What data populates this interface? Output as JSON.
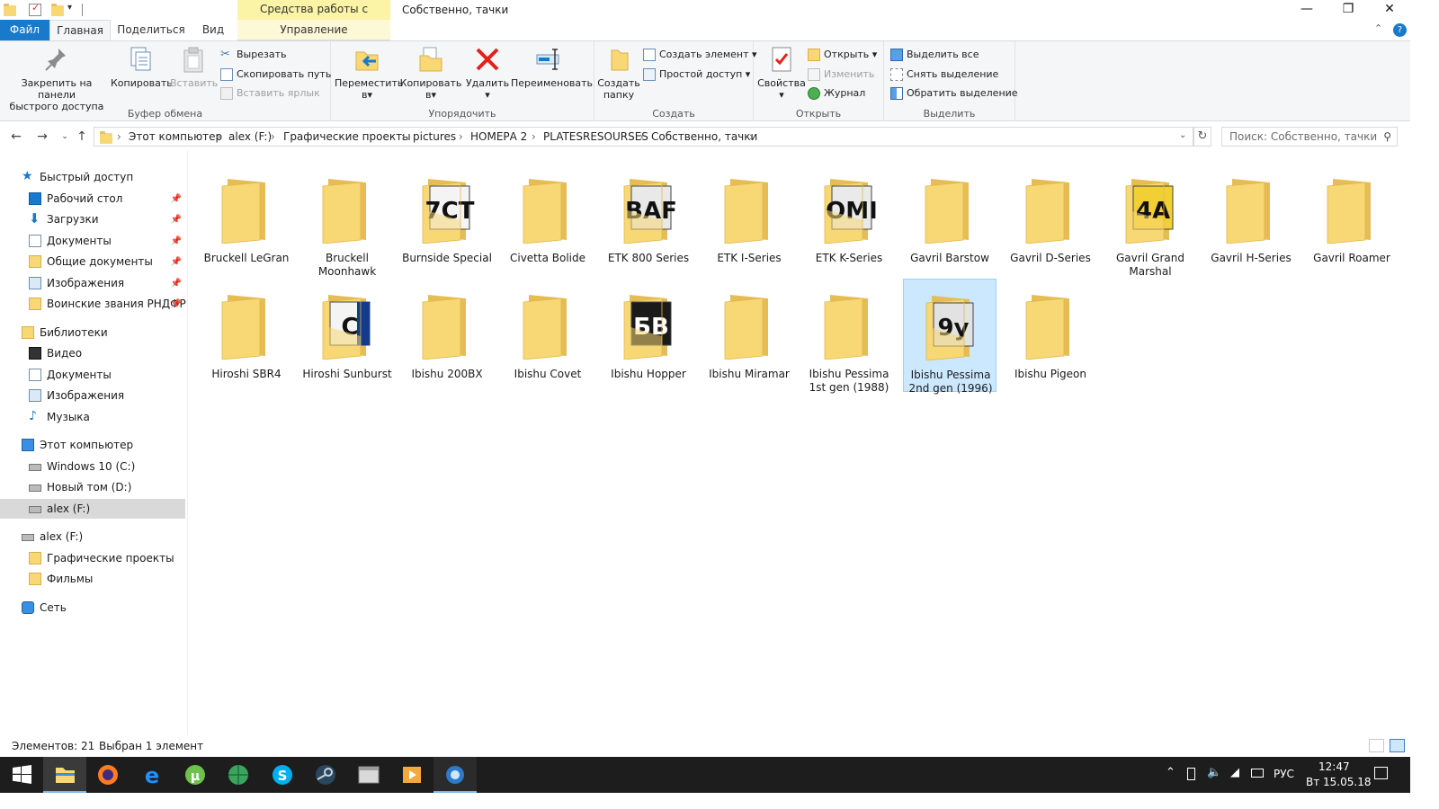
{
  "window": {
    "title": "Собственно, тачки",
    "context_group": "Средства работы с рисунками",
    "controls": {
      "minimize": "—",
      "maximize": "❐",
      "close": "✕"
    }
  },
  "tabs": [
    {
      "label": "Файл"
    },
    {
      "label": "Главная"
    },
    {
      "label": "Поделиться"
    },
    {
      "label": "Вид"
    },
    {
      "label": "Управление"
    }
  ],
  "ribbon": {
    "clipboard": {
      "label": "Буфер обмена",
      "pin": "Закрепить на панели быстрого доступа",
      "pin_l1": "Закрепить на панели",
      "pin_l2": "быстрого доступа",
      "copy": "Копировать",
      "paste": "Вставить",
      "cut": "Вырезать",
      "copy_path": "Скопировать путь",
      "paste_shortcut": "Вставить ярлык"
    },
    "organize": {
      "label": "Упорядочить",
      "move_l1": "Переместить",
      "move_l2": "в",
      "copy_l1": "Копировать",
      "copy_l2": "в",
      "delete": "Удалить",
      "rename": "Переименовать"
    },
    "create": {
      "label": "Создать",
      "new_folder_l1": "Создать",
      "new_folder_l2": "папку",
      "new_item": "Создать элемент",
      "easy_access": "Простой доступ"
    },
    "open": {
      "label": "Открыть",
      "properties": "Свойства",
      "open": "Открыть",
      "edit": "Изменить",
      "history": "Журнал"
    },
    "select": {
      "label": "Выделить",
      "select_all": "Выделить все",
      "select_none": "Снять выделение",
      "invert": "Обратить выделение"
    }
  },
  "address": {
    "crumbs": [
      "Этот компьютер",
      "alex (F:)",
      "Графические проекты",
      "pictures",
      "НОМЕРА 2",
      "PLATESRESOURSES",
      "Собственно, тачки"
    ],
    "search_placeholder": "Поиск: Собственно, тачки"
  },
  "sidebar": {
    "quick_access": "Быстрый доступ",
    "quick_items": [
      "Рабочий стол",
      "Загрузки",
      "Документы",
      "Общие документы",
      "Изображения",
      "Воинские звания РНДФР"
    ],
    "libraries": "Библиотеки",
    "library_items": [
      "Видео",
      "Документы",
      "Изображения",
      "Музыка"
    ],
    "this_pc": "Этот компьютер",
    "pc_items": [
      "Windows 10 (C:)",
      "Новый том (D:)",
      "alex (F:)"
    ],
    "drive": "alex (F:)",
    "drive_items": [
      "Графические проекты",
      "Фильмы"
    ],
    "network": "Сеть"
  },
  "folders": [
    {
      "l1": "Bruckell LeGran",
      "l2": "",
      "plate": ""
    },
    {
      "l1": "Bruckell",
      "l2": "Moonhawk",
      "plate": ""
    },
    {
      "l1": "Burnside Special",
      "l2": "",
      "plate": "7СТ"
    },
    {
      "l1": "Civetta Bolide",
      "l2": "",
      "plate": ""
    },
    {
      "l1": "ETK 800 Series",
      "l2": "",
      "plate": "ВАF"
    },
    {
      "l1": "ETK I-Series",
      "l2": "",
      "plate": ""
    },
    {
      "l1": "ETK K-Series",
      "l2": "",
      "plate": "ОМІ"
    },
    {
      "l1": "Gavril Barstow",
      "l2": "",
      "plate": ""
    },
    {
      "l1": "Gavril D-Series",
      "l2": "",
      "plate": ""
    },
    {
      "l1": "Gavril Grand",
      "l2": "Marshal",
      "plate": "4А"
    },
    {
      "l1": "Gavril H-Series",
      "l2": "",
      "plate": ""
    },
    {
      "l1": "Gavril Roamer",
      "l2": "",
      "plate": ""
    },
    {
      "l1": "Hiroshi SBR4",
      "l2": "",
      "plate": ""
    },
    {
      "l1": "Hiroshi Sunburst",
      "l2": "",
      "plate": "С"
    },
    {
      "l1": "Ibishu 200BX",
      "l2": "",
      "plate": ""
    },
    {
      "l1": "Ibishu Covet",
      "l2": "",
      "plate": ""
    },
    {
      "l1": "Ibishu Hopper",
      "l2": "",
      "plate": "БВ"
    },
    {
      "l1": "Ibishu Miramar",
      "l2": "",
      "plate": ""
    },
    {
      "l1": "Ibishu Pessima",
      "l2": "1st gen (1988)",
      "plate": ""
    },
    {
      "l1": "Ibishu Pessima",
      "l2": "2nd gen (1996)",
      "plate": "9у"
    },
    {
      "l1": "Ibishu Pigeon",
      "l2": "",
      "plate": ""
    }
  ],
  "status": {
    "count": "Элементов: 21",
    "selected": "Выбран 1 элемент"
  },
  "taskbar": {
    "lang": "РУС",
    "time": "12:47",
    "date": "Вт 15.05.18"
  },
  "colors": {
    "accent": "#1979ca",
    "selection": "#cce8ff",
    "folder": "#f8d775",
    "context_tab": "#fbf3a5"
  }
}
